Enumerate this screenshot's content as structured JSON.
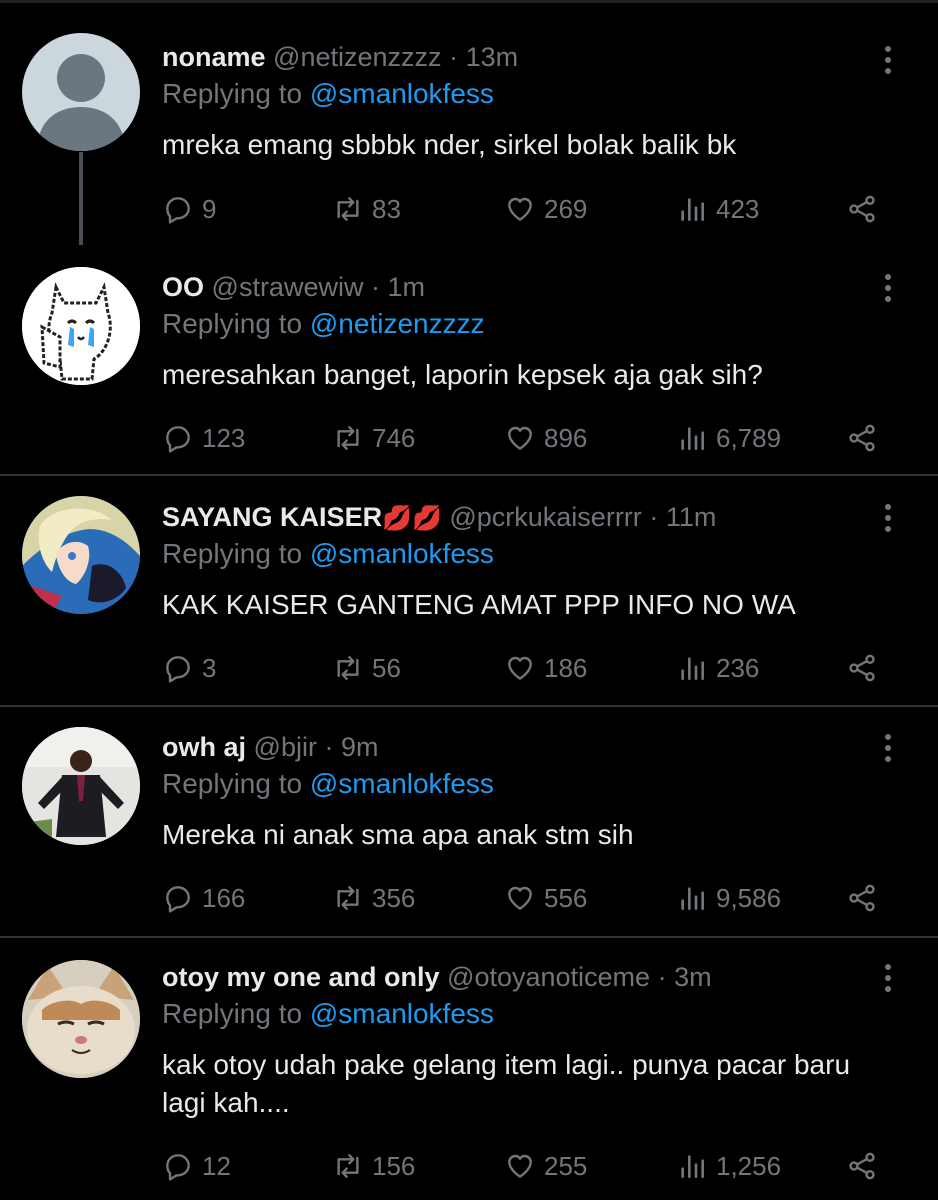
{
  "tweets": [
    {
      "name": "noname",
      "handle": "@netizenzzzz",
      "dot": "·",
      "time": "13m",
      "replying_prefix": "Replying to",
      "replying_to": "@smanlokfess",
      "text": "mreka emang sbbbk nder, sirkel bolak balik bk",
      "replies": "9",
      "retweets": "83",
      "likes": "269",
      "views": "423",
      "avatar": "default-profile-avatar"
    },
    {
      "name": "OO",
      "handle": "@strawewiw",
      "dot": "·",
      "time": "1m",
      "replying_prefix": "Replying to",
      "replying_to": "@netizenzzzz",
      "text": "meresahkan banget, laporin kepsek aja gak sih?",
      "replies": "123",
      "retweets": "746",
      "likes": "896",
      "views": "6,789",
      "avatar": "crying-cat-avatar"
    },
    {
      "name": "SAYANG KAISER",
      "name_emoji": "💋💋",
      "handle": "@pcrkukaiserrrr",
      "dot": "·",
      "time": "11m",
      "replying_prefix": "Replying to",
      "replying_to": "@smanlokfess",
      "text": "KAK KAISER GANTENG AMAT PPP INFO NO WA",
      "replies": "3",
      "retweets": "56",
      "likes": "186",
      "views": "236",
      "avatar": "anime-character-avatar"
    },
    {
      "name": "owh aj",
      "handle": "@bjir",
      "dot": "·",
      "time": "9m",
      "replying_prefix": "Replying to",
      "replying_to": "@smanlokfess",
      "text": "Mereka ni anak sma apa anak stm sih",
      "replies": "166",
      "retweets": "356",
      "likes": "556",
      "views": "9,586",
      "avatar": "man-in-suit-avatar"
    },
    {
      "name": "otoy my one and only",
      "handle": "@otoyanoticeme",
      "dot": "·",
      "time": "3m",
      "replying_prefix": "Replying to",
      "replying_to": "@smanlokfess",
      "text": "kak otoy udah pake gelang item lagi.. punya pacar baru lagi kah....",
      "replies": "12",
      "retweets": "156",
      "likes": "255",
      "views": "1,256",
      "avatar": "cat-face-avatar"
    }
  ],
  "colors": {
    "background": "#000000",
    "text": "#e7e9ea",
    "secondary": "#71767b",
    "mention": "#1d9bf0",
    "divider": "#2f3336"
  }
}
